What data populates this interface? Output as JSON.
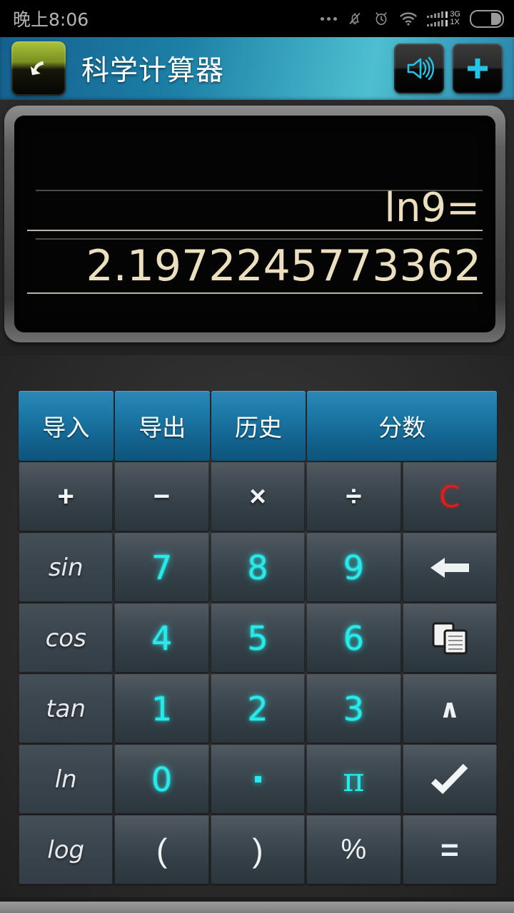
{
  "status_bar": {
    "time": "晚上8:06",
    "icons": {
      "more": "more-dots-icon",
      "mute": "bell-muted-icon",
      "alarm": "alarm-clock-icon",
      "wifi": "wifi-icon",
      "signal": "signal-bars-icon",
      "battery": "battery-icon"
    },
    "network_labels": [
      "3G",
      "1X"
    ]
  },
  "title_bar": {
    "back": "back-arrow-icon",
    "title": "科学计算器",
    "sound": "speaker-icon",
    "add": "plus-icon"
  },
  "display": {
    "expression": "ln9=",
    "result": "2.1972245773362",
    "text_color": "#ecdfbd"
  },
  "keypad": {
    "rows": [
      {
        "kind": "blue",
        "keys": [
          {
            "label": "导入",
            "name": "import-button",
            "wide": false
          },
          {
            "label": "导出",
            "name": "export-button",
            "wide": false
          },
          {
            "label": "历史",
            "name": "history-button",
            "wide": false
          },
          {
            "label": "分数",
            "name": "fraction-button",
            "wide": true
          }
        ]
      },
      {
        "kind": "ops",
        "keys": [
          {
            "label": "+",
            "name": "plus-button"
          },
          {
            "label": "−",
            "name": "minus-button"
          },
          {
            "label": "×",
            "name": "multiply-button"
          },
          {
            "label": "÷",
            "name": "divide-button"
          },
          {
            "label": "C",
            "name": "clear-button"
          }
        ]
      },
      {
        "kind": "num",
        "keys": [
          {
            "label": "sin",
            "name": "sin-button"
          },
          {
            "label": "7",
            "name": "digit-7-button"
          },
          {
            "label": "8",
            "name": "digit-8-button"
          },
          {
            "label": "9",
            "name": "digit-9-button"
          },
          {
            "label": "",
            "name": "backspace-button"
          }
        ]
      },
      {
        "kind": "num",
        "keys": [
          {
            "label": "cos",
            "name": "cos-button"
          },
          {
            "label": "4",
            "name": "digit-4-button"
          },
          {
            "label": "5",
            "name": "digit-5-button"
          },
          {
            "label": "6",
            "name": "digit-6-button"
          },
          {
            "label": "",
            "name": "copy-button"
          }
        ]
      },
      {
        "kind": "num",
        "keys": [
          {
            "label": "tan",
            "name": "tan-button"
          },
          {
            "label": "1",
            "name": "digit-1-button"
          },
          {
            "label": "2",
            "name": "digit-2-button"
          },
          {
            "label": "3",
            "name": "digit-3-button"
          },
          {
            "label": "∧",
            "name": "power-button"
          }
        ]
      },
      {
        "kind": "num",
        "keys": [
          {
            "label": "ln",
            "name": "ln-button"
          },
          {
            "label": "0",
            "name": "digit-0-button"
          },
          {
            "label": "·",
            "name": "decimal-point-button"
          },
          {
            "label": "π",
            "name": "pi-button"
          },
          {
            "label": "✓",
            "name": "sqrt-button"
          }
        ]
      },
      {
        "kind": "num",
        "keys": [
          {
            "label": "log",
            "name": "log-button"
          },
          {
            "label": "(",
            "name": "open-paren-button"
          },
          {
            "label": ")",
            "name": "close-paren-button"
          },
          {
            "label": "%",
            "name": "percent-button"
          },
          {
            "label": "=",
            "name": "equals-button"
          }
        ]
      }
    ]
  },
  "colors": {
    "accent_blue": "#1d7aa8",
    "digit_cyan": "#27eaea",
    "clear_red": "#e21b1b",
    "lcd_text": "#ecdfbd",
    "title_bar_teal": "#4dbfd0"
  }
}
